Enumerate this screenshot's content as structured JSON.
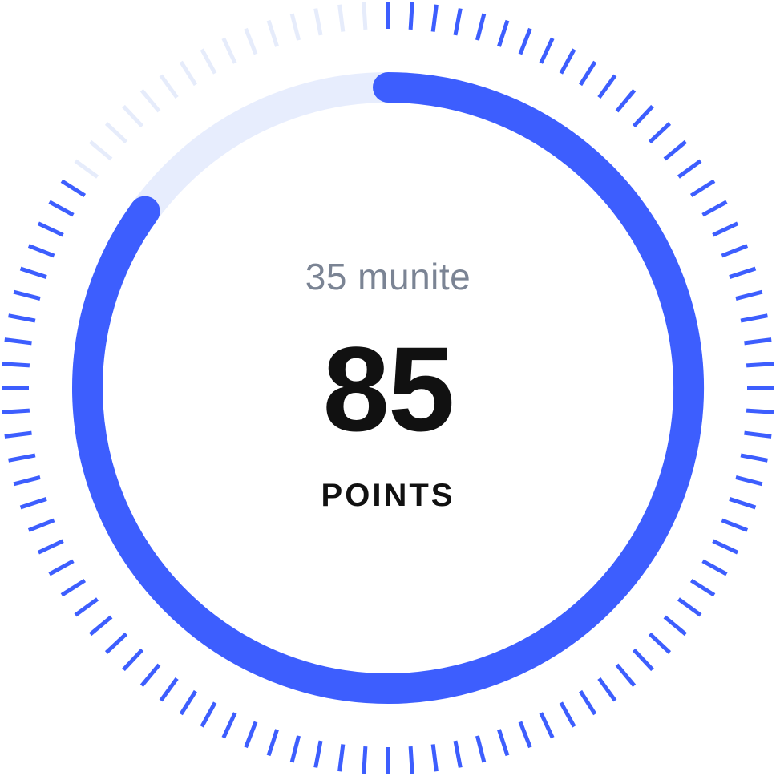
{
  "gauge": {
    "duration_label": "35 munite",
    "score_value": "85",
    "score_unit": "POINTS",
    "progress_fraction": 0.85,
    "accent_color": "#3d5efe",
    "track_color": "#e7edfd",
    "tick_inactive_color": "#e6ecfb"
  }
}
